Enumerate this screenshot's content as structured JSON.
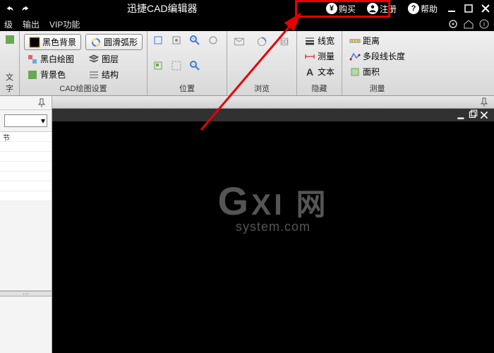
{
  "title": "迅捷CAD编辑器",
  "titlebar": {
    "buy": "购买",
    "register": "注册",
    "help": "帮助"
  },
  "menu": {
    "item1": "级",
    "item2": "输出",
    "item3": "VIP功能"
  },
  "ribbon": {
    "g0": {
      "big": "文字"
    },
    "g1": {
      "label": "CAD绘图设置",
      "btn1": "黑色背景",
      "btn2": "圆滑弧形",
      "btn3": "黑白绘图",
      "btn4": "图层",
      "btn5": "背景色",
      "btn6": "结构"
    },
    "g2": {
      "label": "位置"
    },
    "g3": {
      "label": "浏览"
    },
    "g4": {
      "label": "隐藏",
      "btn1": "线宽",
      "btn2": "测量",
      "btn3": "文本"
    },
    "g5": {
      "label": "测量",
      "btn1": "距离",
      "btn2": "多段线长度",
      "btn3": "面积"
    }
  },
  "side": {
    "item1": "节"
  },
  "watermark": {
    "big_g": "G",
    "big_rest": "XI 网",
    "small": "system.com"
  },
  "colors": {
    "highlight": "#e60000",
    "arrow": "#e60000"
  }
}
